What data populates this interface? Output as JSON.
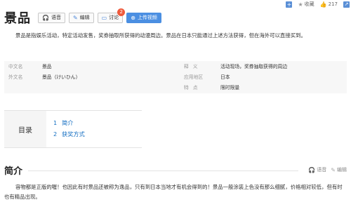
{
  "topbar": {
    "collect_label": "收藏",
    "like_count": "217"
  },
  "header": {
    "title": "景品",
    "buttons": {
      "voice": "语音",
      "edit": "编辑",
      "discuss": "讨论",
      "discuss_badge": "2",
      "upload": "上传视频"
    }
  },
  "intro": "景品是指娱乐活动，特定活动发售，奖券抽取所获得的动漫周边。景品在日本只能通过上述方法获得，但在海外可以直接买到。",
  "infobox": {
    "left": [
      {
        "label": "中文名",
        "value": "景品"
      },
      {
        "label": "外文名",
        "value": "景品（けいひん）"
      }
    ],
    "right": [
      {
        "label": "释义",
        "value": "活动现场，奖券抽取获得的周边"
      },
      {
        "label": "应用地区",
        "value": "日本"
      },
      {
        "label": "特点",
        "value": "限时限量"
      }
    ]
  },
  "toc": {
    "heading": "目录",
    "items": [
      {
        "num": "1",
        "label": "简介"
      },
      {
        "num": "2",
        "label": "获奖方式"
      }
    ]
  },
  "section": {
    "title": "简介",
    "voice": "语音",
    "edit": "编辑",
    "text": "容物都是正版的喔！也因此有时景品还被称为逸品，只有到日本当地才有机会得到的！景品一般涂装上色没有那么细腻，价格相对较低，但有时也有精品出现。"
  },
  "colors": {
    "primary": "#4b8fe2",
    "badge": "#ef5a3c",
    "link": "#136ec2"
  }
}
